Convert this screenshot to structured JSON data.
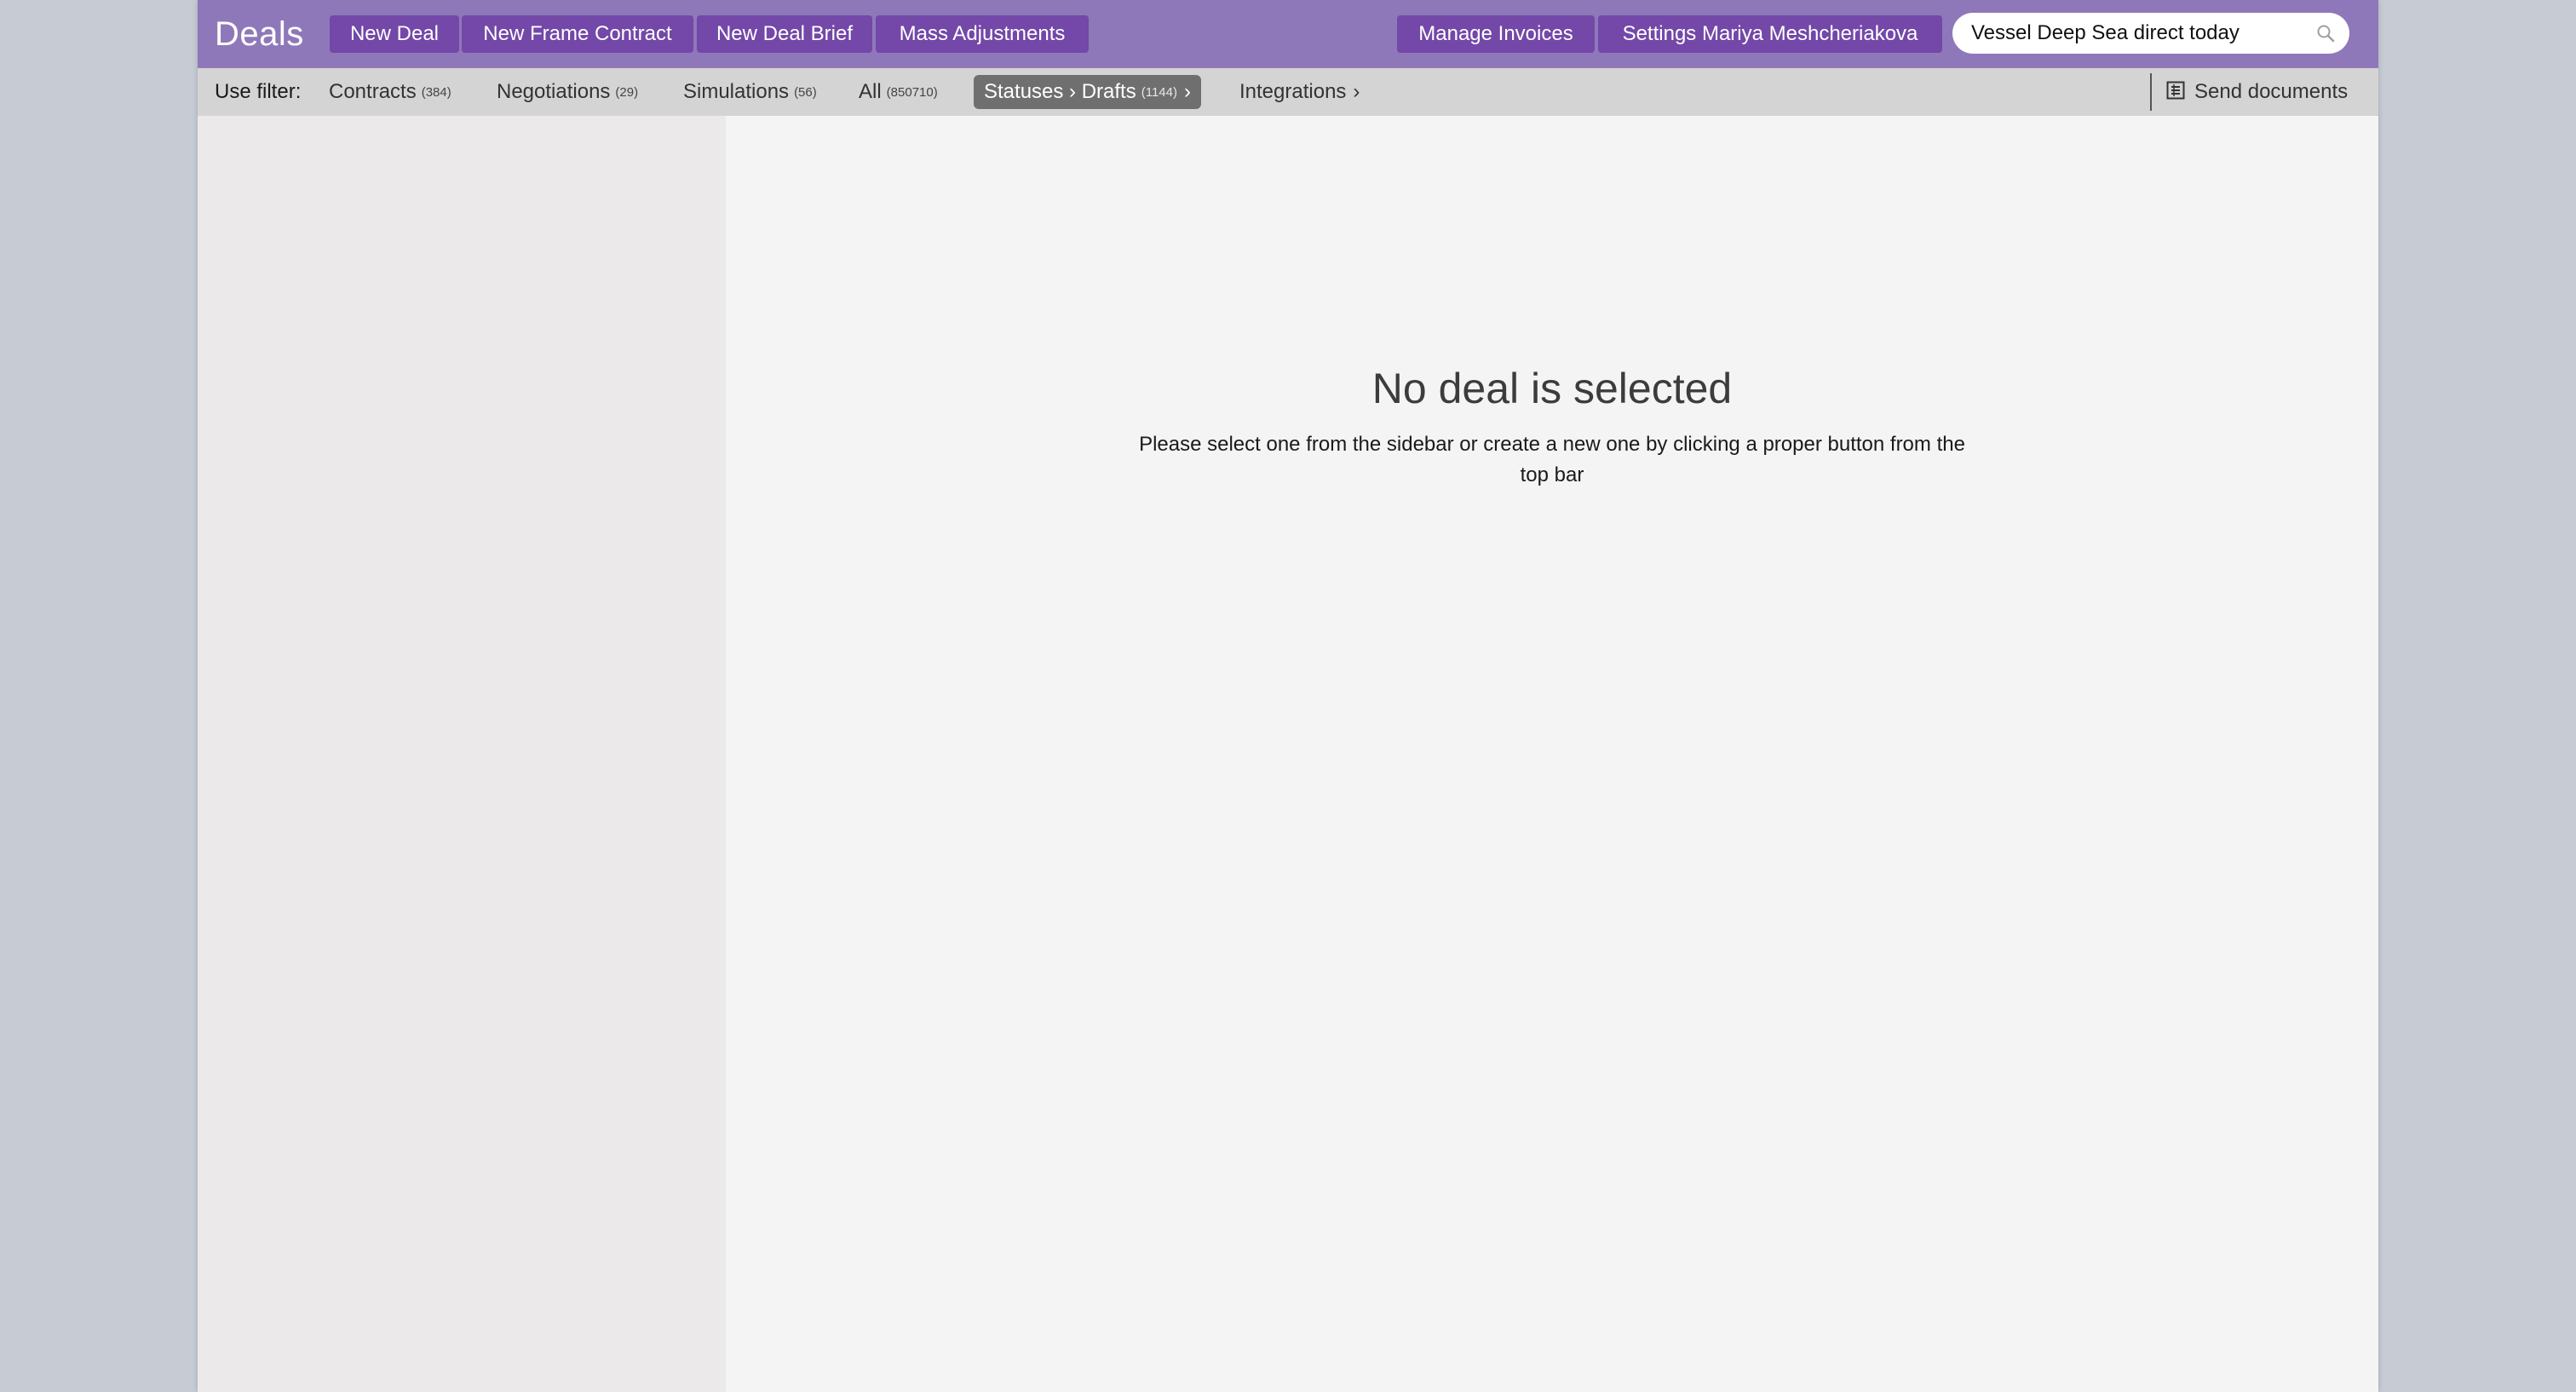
{
  "app": {
    "title": "Deals"
  },
  "toolbar": {
    "new_deal": "New Deal",
    "new_frame_contract": "New Frame Contract",
    "new_deal_brief": "New Deal Brief",
    "mass_adjustments": "Mass Adjustments",
    "manage_invoices": "Manage Invoices",
    "settings": "Settings Mariya Meshcheriakova"
  },
  "search": {
    "value": "Vessel Deep Sea direct today",
    "icon": "search-icon"
  },
  "filters": {
    "label": "Use filter:",
    "items": [
      {
        "label": "Contracts",
        "count": "(384)"
      },
      {
        "label": "Negotiations",
        "count": "(29)"
      },
      {
        "label": "Simulations",
        "count": "(56)"
      },
      {
        "label": "All",
        "count": "(850710)"
      },
      {
        "label": "Statuses › Drafts",
        "count": "(1144)",
        "chevron": "›",
        "active": true
      },
      {
        "label": "Integrations",
        "chevron": "›"
      }
    ],
    "send_documents": "Send documents"
  },
  "empty_state": {
    "title": "No deal is selected",
    "description": "Please select one from the sidebar or create a new one by clicking a proper button from the top bar"
  },
  "colors": {
    "topbar": "#8e78b9",
    "button": "#7348a8",
    "filterbar": "#d4d4d4",
    "active_filter": "#6f6f6f",
    "sidebar": "#ebe9ea",
    "main": "#f4f4f4"
  }
}
